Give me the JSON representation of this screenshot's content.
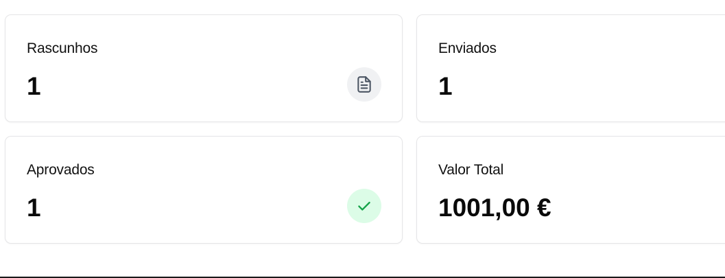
{
  "stats": {
    "drafts": {
      "label": "Rascunhos",
      "value": "1",
      "icon": "document-icon",
      "icon_color": "#4b5563",
      "icon_bg": "#f0f1f3"
    },
    "sent": {
      "label": "Enviados",
      "value": "1"
    },
    "approved": {
      "label": "Aprovados",
      "value": "1",
      "icon": "check-icon",
      "icon_color": "#16a34a",
      "icon_bg": "#dcfce7"
    },
    "total_value": {
      "label": "Valor Total",
      "value": "1001,00 €"
    }
  }
}
